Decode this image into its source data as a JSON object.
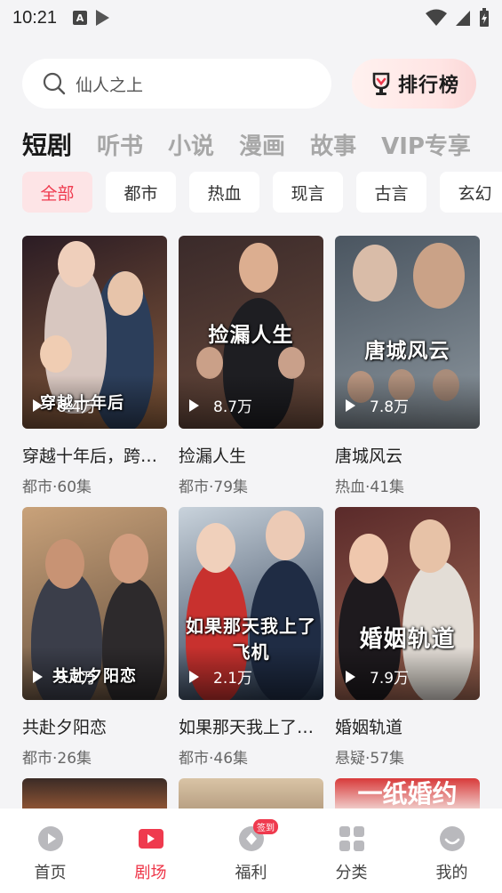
{
  "status_bar": {
    "time": "10:21",
    "badge_letter": "A"
  },
  "search": {
    "placeholder": "仙人之上"
  },
  "rank_button": {
    "label": "排行榜"
  },
  "category_tabs": [
    {
      "label": "短剧",
      "active": true
    },
    {
      "label": "听书",
      "active": false
    },
    {
      "label": "小说",
      "active": false
    },
    {
      "label": "漫画",
      "active": false
    },
    {
      "label": "故事",
      "active": false
    },
    {
      "label": "VIP专享",
      "active": false
    }
  ],
  "genre_chips": [
    {
      "label": "全部",
      "active": true
    },
    {
      "label": "都市",
      "active": false
    },
    {
      "label": "热血",
      "active": false
    },
    {
      "label": "现言",
      "active": false
    },
    {
      "label": "古言",
      "active": false
    },
    {
      "label": "玄幻",
      "active": false
    }
  ],
  "dramas": [
    {
      "title": "穿越十年后，跨越时空的爱",
      "meta": "都市·60集",
      "plays": "6.4万",
      "poster_text": "穿越十年后",
      "colors": [
        "#2b1c24",
        "#8a5d3c"
      ]
    },
    {
      "title": "捡漏人生",
      "meta": "都市·79集",
      "plays": "8.7万",
      "poster_text": "捡漏人生",
      "colors": [
        "#3a2a2a",
        "#6b4b3c"
      ]
    },
    {
      "title": "唐城风云",
      "meta": "热血·41集",
      "plays": "7.8万",
      "poster_text": "唐城风云",
      "colors": [
        "#4a5560",
        "#8c969e"
      ]
    },
    {
      "title": "共赴夕阳恋",
      "meta": "都市·26集",
      "plays": "9.7万",
      "poster_text": "共赴夕阳恋",
      "colors": [
        "#c9a27a",
        "#5e4a3a"
      ]
    },
    {
      "title": "如果那天我上了飞机",
      "meta": "都市·46集",
      "plays": "2.1万",
      "poster_text": "如果那天我上了飞机",
      "colors": [
        "#c9d3dc",
        "#22324a"
      ]
    },
    {
      "title": "婚姻轨道",
      "meta": "悬疑·57集",
      "plays": "7.9万",
      "poster_text": "婚姻轨道",
      "colors": [
        "#5a2a2a",
        "#a36a55"
      ]
    }
  ],
  "partial_posters": [
    {
      "colors": [
        "#3b2b26",
        "#9a5a36"
      ]
    },
    {
      "colors": [
        "#d9c4a6",
        "#b39a7e"
      ]
    },
    {
      "colors": [
        "#d83a3a",
        "#f4e3e0"
      ],
      "text": "一纸婚约"
    }
  ],
  "bottom_nav": [
    {
      "label": "首页",
      "active": false,
      "icon": "home-play-icon"
    },
    {
      "label": "剧场",
      "active": true,
      "icon": "theater-icon"
    },
    {
      "label": "福利",
      "active": false,
      "icon": "welfare-icon",
      "badge": "签到"
    },
    {
      "label": "分类",
      "active": false,
      "icon": "category-grid-icon"
    },
    {
      "label": "我的",
      "active": false,
      "icon": "profile-icon"
    }
  ],
  "accent_color": "#ef3a4e"
}
